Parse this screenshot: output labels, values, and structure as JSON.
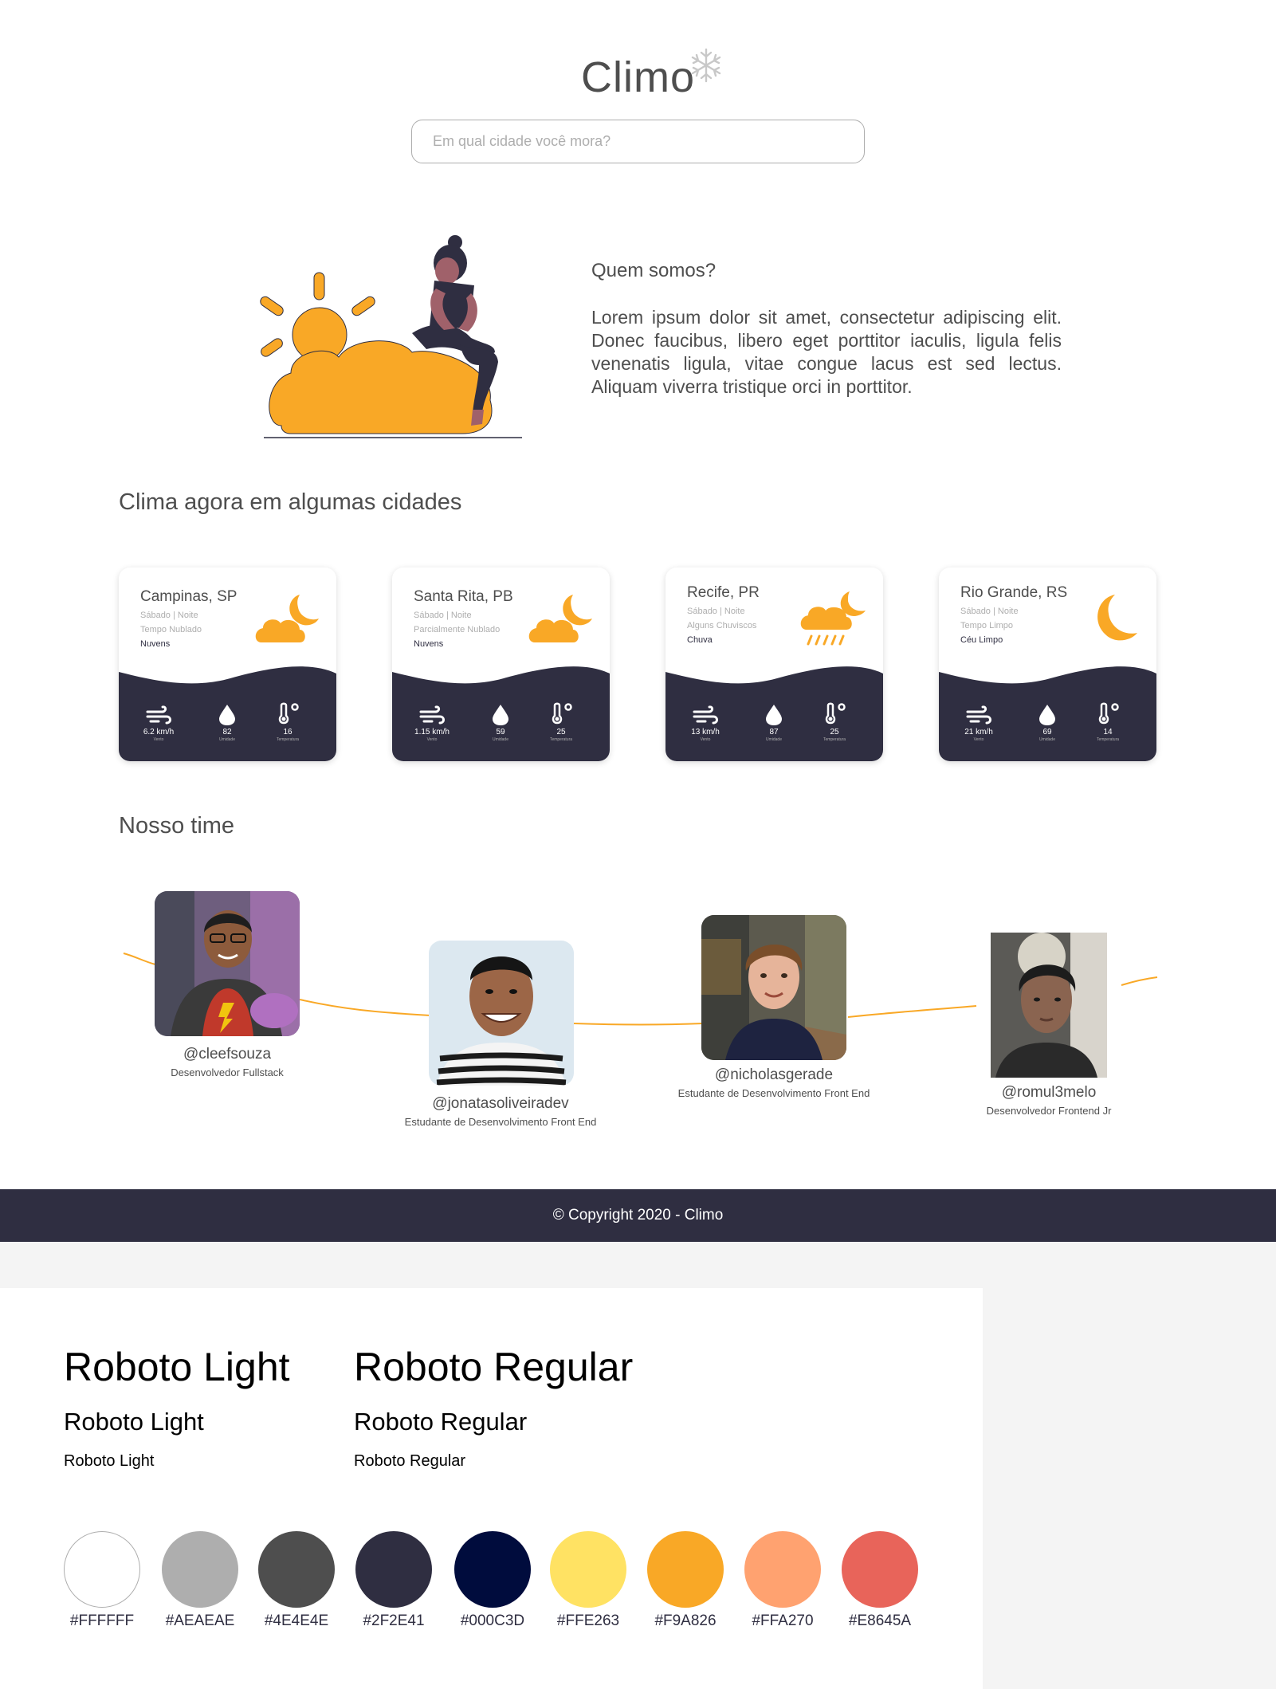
{
  "header": {
    "logo": "Climo",
    "search_placeholder": "Em qual cidade você mora?"
  },
  "about": {
    "title": "Quem somos?",
    "text": "Lorem ipsum dolor sit amet, consectetur adipiscing elit. Donec faucibus, libero eget porttitor iaculis, ligula felis venenatis ligula, vitae congue lacus est sed lectus. Aliquam viverra tristique orci in porttitor."
  },
  "weather": {
    "title": "Clima agora em algumas cidades",
    "cards": [
      {
        "city": "Campinas, SP",
        "day": "Sábado | Noite",
        "desc": "Tempo Nublado",
        "cond": "Nuvens",
        "icon": "cloud-moon-icon",
        "wind": "6.2 km/h",
        "wind_label": "Vento",
        "humidity": "82",
        "humidity_label": "Umidade",
        "temp": "16",
        "temp_label": "Temperatura"
      },
      {
        "city": "Santa Rita, PB",
        "day": "Sábado | Noite",
        "desc": "Parcialmente Nublado",
        "cond": "Nuvens",
        "icon": "cloud-moon-icon",
        "wind": "1.15 km/h",
        "wind_label": "Vento",
        "humidity": "59",
        "humidity_label": "Umidade",
        "temp": "25",
        "temp_label": "Temperatura"
      },
      {
        "city": "Recife, PR",
        "day": "Sábado | Noite",
        "desc": "Alguns Chuviscos",
        "cond": "Chuva",
        "icon": "rain-moon-icon",
        "wind": "13 km/h",
        "wind_label": "Vento",
        "humidity": "87",
        "humidity_label": "Umidade",
        "temp": "25",
        "temp_label": "Temperatura"
      },
      {
        "city": "Rio Grande, RS",
        "day": "Sábado | Noite",
        "desc": "Tempo Limpo",
        "cond": "Céu Limpo",
        "icon": "moon-icon",
        "wind": "21 km/h",
        "wind_label": "Vento",
        "humidity": "69",
        "humidity_label": "Umidade",
        "temp": "14",
        "temp_label": "Temperatura"
      }
    ]
  },
  "team": {
    "title": "Nosso time",
    "members": [
      {
        "handle": "@cleefsouza",
        "role": "Desenvolvedor Fullstack"
      },
      {
        "handle": "@jonatasoliveiradev",
        "role": "Estudante de Desenvolvimento Front End"
      },
      {
        "handle": "@nicholasgerade",
        "role": "Estudante de Desenvolvimento Front End"
      },
      {
        "handle": "@romul3melo",
        "role": "Desenvolvedor Frontend Jr"
      }
    ]
  },
  "footer": {
    "text": "© Copyright 2020 - Climo"
  },
  "styleguide": {
    "light_l": "Roboto Light",
    "light_m": "Roboto Light",
    "light_s": "Roboto Light",
    "reg_l": "Roboto Regular",
    "reg_m": "Roboto Regular",
    "reg_s": "Roboto Regular",
    "colors": [
      "#FFFFFF",
      "#AEAEAE",
      "#4E4E4E",
      "#2F2E41",
      "#000C3D",
      "#FFE263",
      "#F9A826",
      "#FFA270",
      "#E8645A"
    ]
  }
}
